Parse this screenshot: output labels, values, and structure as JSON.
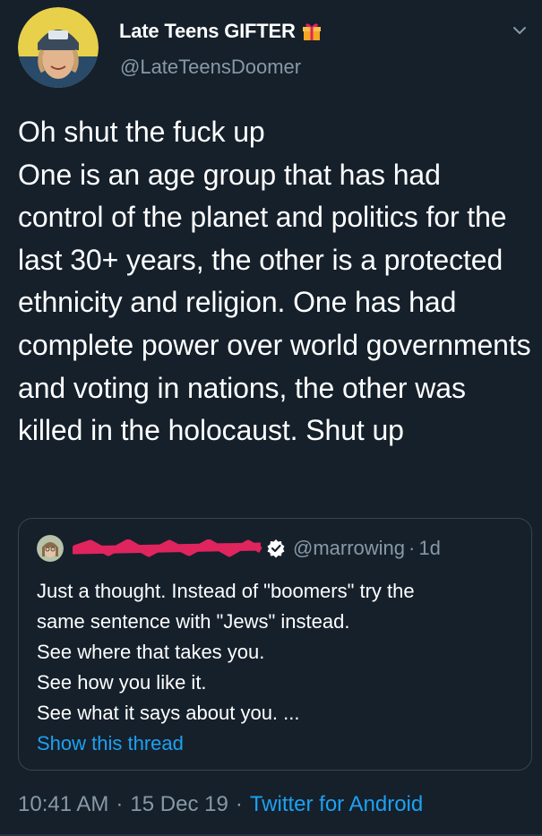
{
  "tweet": {
    "author": {
      "display_name": "Late Teens GIFTER",
      "name_emoji": "gift-icon",
      "handle": "@LateTeensDoomer",
      "avatar": "avatar-photo"
    },
    "text": "Oh shut the fuck up\nOne is an age group that has had control of the planet and politics for the last 30+ years, the other is a protected ethnicity and religion. One has had complete power over world governments and voting in nations, the other was killed in the holocaust. Shut up",
    "quoted_tweet": {
      "author_name_redacted": true,
      "verified": true,
      "handle": "@marrowing",
      "separator": "·",
      "time": "1d",
      "lines": [
        "Just a thought. Instead of \"boomers\" try the",
        "same sentence with \"Jews\" instead.",
        "See where that takes you.",
        "See how you like it.",
        "See what it says about you. ..."
      ],
      "show_thread": "Show this thread"
    },
    "meta": {
      "time": "10:41 AM",
      "dot1": "·",
      "date": "15 Dec 19",
      "dot2": "·",
      "source": "Twitter for Android"
    }
  },
  "colors": {
    "background": "#15202b",
    "secondary_text": "#8899a6",
    "accent": "#1da1f2",
    "border": "#38444d",
    "redaction": "#e0245e"
  }
}
